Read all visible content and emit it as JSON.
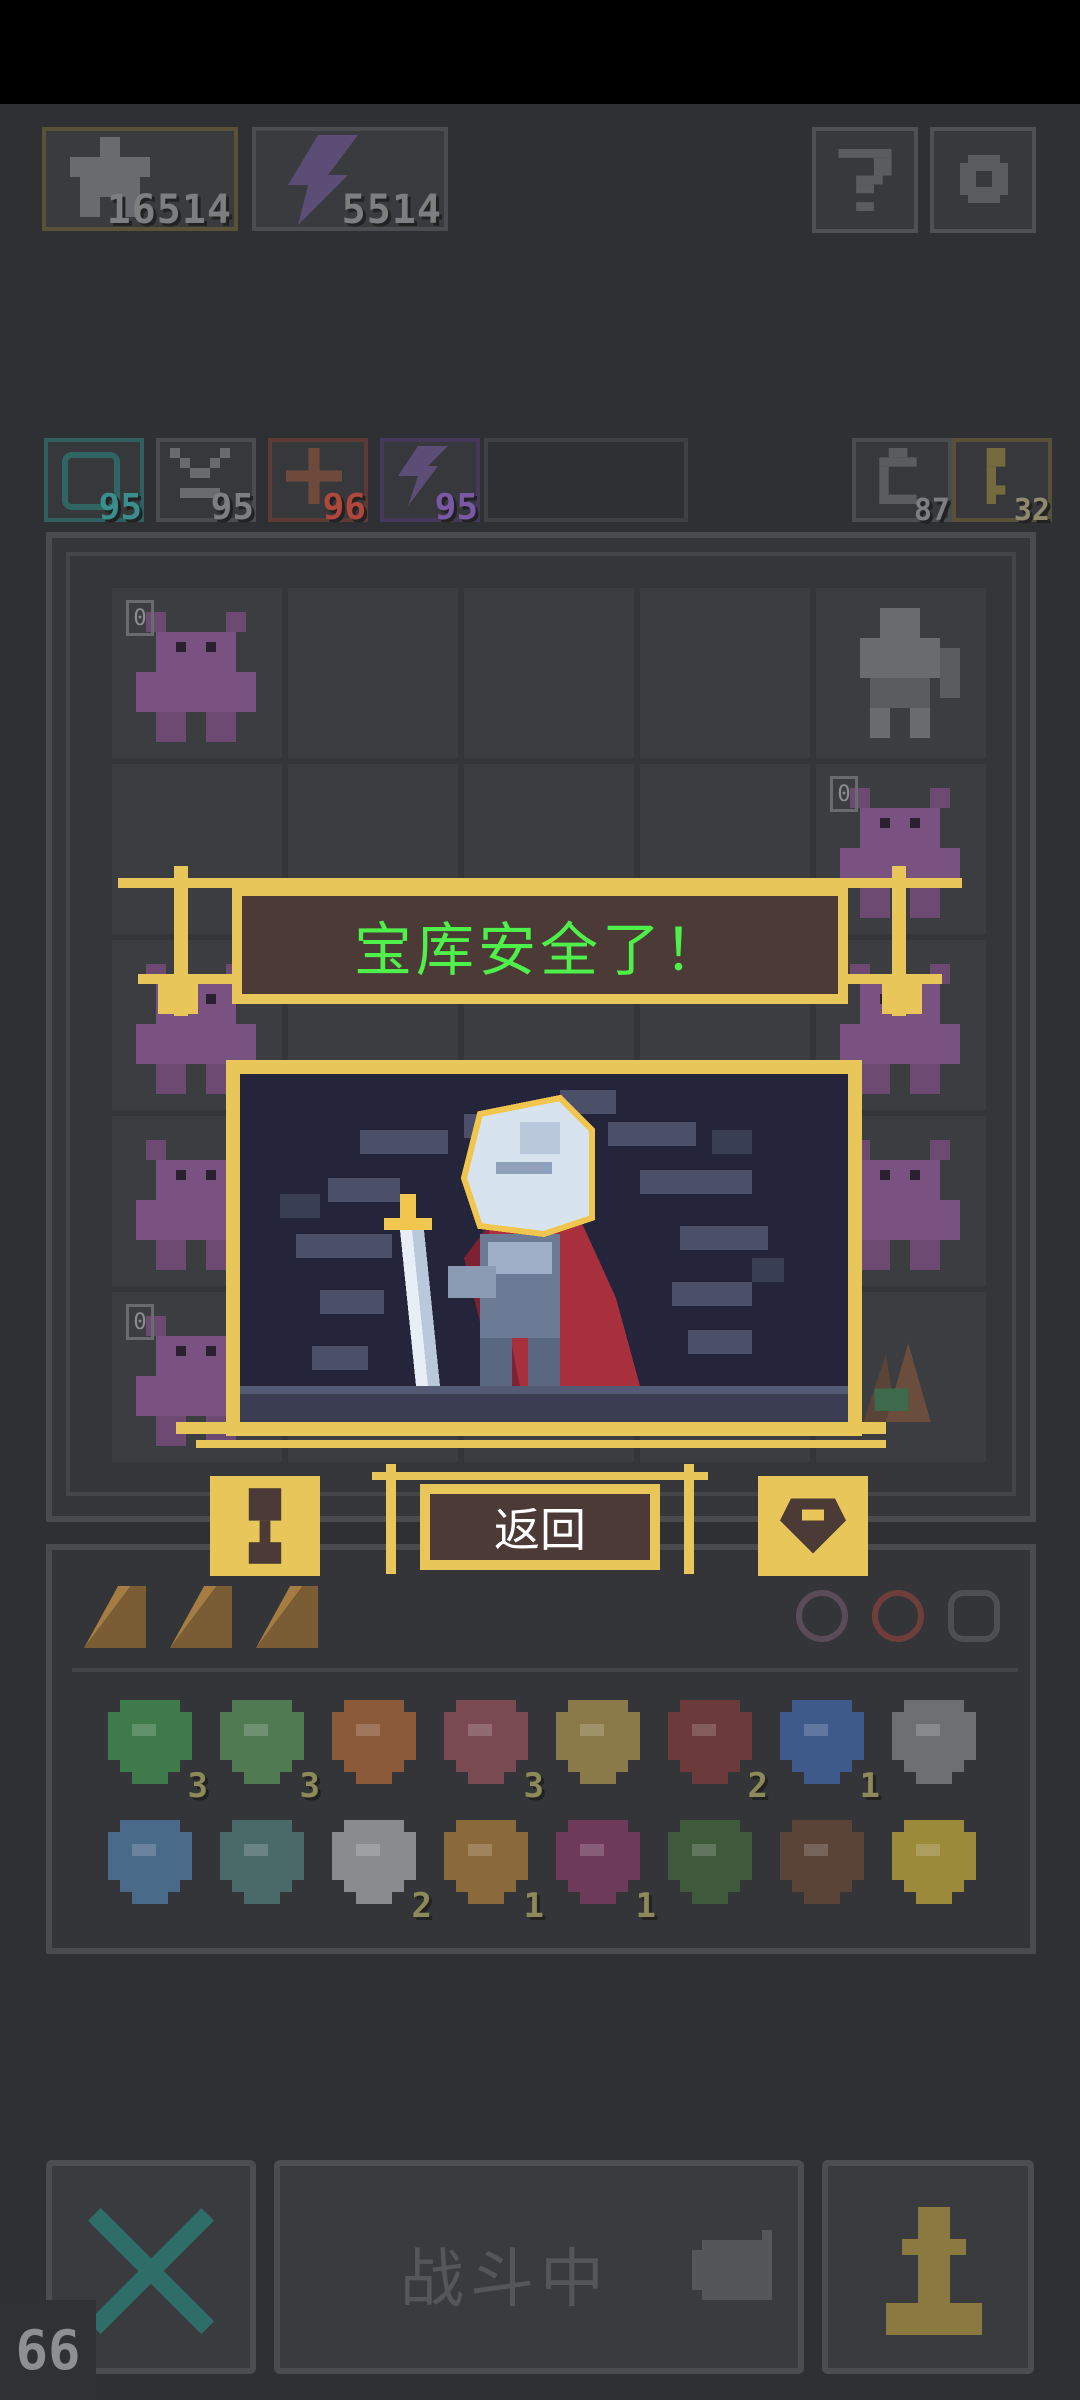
{
  "resources": {
    "stars": "16514",
    "energy": "5514"
  },
  "stats": [
    {
      "value": "95",
      "color": "#3a8f8d"
    },
    {
      "value": "95",
      "color": "#7d7e80"
    },
    {
      "value": "96",
      "color": "#b0473c"
    },
    {
      "value": "95",
      "color": "#7a58a8"
    }
  ],
  "side_counters": {
    "undo": "87",
    "key": "32"
  },
  "board": {
    "monster_level_badge": "0"
  },
  "inventory": {
    "items": [
      {
        "icon": "green-gem-icon",
        "count": "3"
      },
      {
        "icon": "green-potion-icon",
        "count": "3"
      },
      {
        "icon": "shield-icon",
        "count": ""
      },
      {
        "icon": "helmet-icon",
        "count": "3"
      },
      {
        "icon": "trident-icon",
        "count": ""
      },
      {
        "icon": "red-jar-icon",
        "count": "2"
      },
      {
        "icon": "hourglass-icon",
        "count": "1"
      },
      {
        "icon": "mirror-icon",
        "count": ""
      },
      {
        "icon": "blue-scroll-icon",
        "count": ""
      },
      {
        "icon": "bell-icon",
        "count": ""
      },
      {
        "icon": "claw-icon",
        "count": "2"
      },
      {
        "icon": "ring-icon",
        "count": "1"
      },
      {
        "icon": "demon-icon",
        "count": "1"
      },
      {
        "icon": "map-icon",
        "count": ""
      },
      {
        "icon": "crystal-icon",
        "count": ""
      },
      {
        "icon": "golden-key-icon",
        "count": ""
      }
    ]
  },
  "dialog": {
    "title": "宝库安全了！",
    "back_label": "返回"
  },
  "bottom": {
    "battle_label": "战斗中",
    "fps": "66"
  },
  "colors": {
    "gold": "#e8c65a",
    "title_text": "#4ef04a",
    "dialog_bg": "#4b3a36"
  }
}
